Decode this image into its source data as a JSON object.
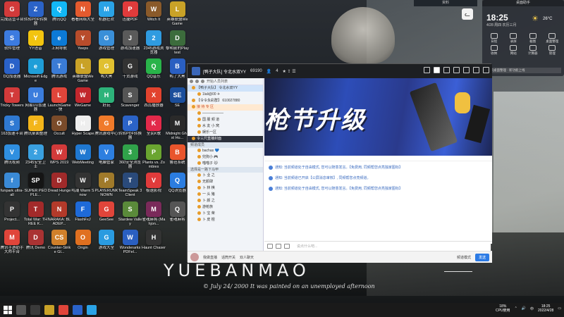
{
  "desktop_icons": [
    {
      "label": "完成运营平台",
      "color": "#d23a3a",
      "glyph": "G"
    },
    {
      "label": "转转PDF转换器",
      "color": "#2b63c7",
      "glyph": "Z"
    },
    {
      "label": "腾讯QQ",
      "color": "#12b7f5",
      "glyph": "Q"
    },
    {
      "label": "看看网络大全",
      "color": "#e45a2e",
      "glyph": "N"
    },
    {
      "label": "机器狂欢",
      "color": "#2aa3e6",
      "glyph": "M"
    },
    {
      "label": "迅捷PDF",
      "color": "#e03b3b",
      "glyph": "P"
    },
    {
      "label": "Witch It",
      "color": "#8a5a2a",
      "glyph": "W"
    },
    {
      "label": "英雄联盟WeGame",
      "color": "#c9a227",
      "glyph": "L"
    },
    {
      "label": "软件管理",
      "color": "#3c7be0",
      "glyph": "S"
    },
    {
      "label": "YY语音",
      "color": "#f2c40f",
      "glyph": "Y"
    },
    {
      "label": "上网导航",
      "color": "#0c7ad6",
      "glyph": "e"
    },
    {
      "label": "Yeeps",
      "color": "#b84c2b",
      "glyph": "Y"
    },
    {
      "label": "游戏管理",
      "color": "#3a8fd8",
      "glyph": "G"
    },
    {
      "label": "游戏加速器",
      "color": "#5a5a5a",
      "glyph": "J"
    },
    {
      "label": "2345游戏浏览器",
      "color": "#2f9be0",
      "glyph": "2"
    },
    {
      "label": "黎明前的Playtest",
      "color": "#3c6c3c",
      "glyph": "D"
    },
    {
      "label": "DQ加速器",
      "color": "#2a62c9",
      "glyph": "D"
    },
    {
      "label": "Microsoft Edge",
      "color": "#1f9ed8",
      "glyph": "e"
    },
    {
      "label": "腾讯游戏",
      "color": "#3a7bd5",
      "glyph": "T"
    },
    {
      "label": "英雄联盟WeGame",
      "color": "#c9a227",
      "glyph": "L"
    },
    {
      "label": "鸭大黑",
      "color": "#e0c030",
      "glyph": "G"
    },
    {
      "label": "干货游戏",
      "color": "#333",
      "glyph": "G"
    },
    {
      "label": "QQ音乐",
      "color": "#29b34a",
      "glyph": "Q"
    },
    {
      "label": "鸭了大黑",
      "color": "#2a5fc1",
      "glyph": "B"
    },
    {
      "label": "Tricky Towers",
      "color": "#d23a3a",
      "glyph": "T"
    },
    {
      "label": "网易UU加速器",
      "color": "#3b7ddd",
      "glyph": "U"
    },
    {
      "label": "LaunchGame - 快",
      "color": "#e0453a",
      "glyph": "L"
    },
    {
      "label": "WeGame",
      "color": "#c2272d",
      "glyph": "W"
    },
    {
      "label": "好玩",
      "color": "#2db37a",
      "glyph": "H"
    },
    {
      "label": "Scavenger",
      "color": "#555",
      "glyph": "S"
    },
    {
      "label": "西瓜播放器",
      "color": "#e2432e",
      "glyph": "X"
    },
    {
      "label": "SE",
      "color": "#1b4f9c",
      "glyph": "SE"
    },
    {
      "label": "163加速平台",
      "color": "#2f79d2",
      "glyph": "S"
    },
    {
      "label": "腾讯桌面整理",
      "color": "#f3b51a",
      "glyph": "F"
    },
    {
      "label": "Occult",
      "color": "#7a4b2a",
      "glyph": "O"
    },
    {
      "label": "Hyper Scape",
      "color": "#eeeeee",
      "glyph": "H"
    },
    {
      "label": "腾讯游戏中心",
      "color": "#f07a2a",
      "glyph": "G"
    },
    {
      "label": "转转PDF转换器",
      "color": "#2b63c7",
      "glyph": "P"
    },
    {
      "label": "全民K歌",
      "color": "#e2294a",
      "glyph": "K"
    },
    {
      "label": "Midnight Ghost Hu...",
      "color": "#2a2a2a",
      "glyph": "M"
    },
    {
      "label": "腾讯视频",
      "color": "#2f8fe0",
      "glyph": "V"
    },
    {
      "label": "2345安全卫士",
      "color": "#3aa0e0",
      "glyph": "2"
    },
    {
      "label": "WPS 2019",
      "color": "#d23a3a",
      "glyph": "W"
    },
    {
      "label": "WebMeeting",
      "color": "#1f78d1",
      "glyph": "W"
    },
    {
      "label": "电脑管家",
      "color": "#2d7fe0",
      "glyph": "V"
    },
    {
      "label": "360安全浏览器",
      "color": "#30a24a",
      "glyph": "3"
    },
    {
      "label": "Plants vs. Zombies",
      "color": "#6aa530",
      "glyph": "P"
    },
    {
      "label": "鲁班系统",
      "color": "#e9552c",
      "glyph": "B"
    },
    {
      "label": "funpark ultra-all",
      "color": "#3a8ad6",
      "glyph": "f"
    },
    {
      "label": "SUPER PEOPLE...",
      "color": "#151515",
      "glyph": "SP"
    },
    {
      "label": "Dread Hunger",
      "color": "#a02a2a",
      "glyph": "D"
    },
    {
      "label": "鸣潮 Warm Snow",
      "color": "#333",
      "glyph": "W"
    },
    {
      "label": "PLAYERUNKNOWN",
      "color": "#a07a2a",
      "glyph": "P"
    },
    {
      "label": "TeamSpeak 3 Client",
      "color": "#2a4a7a",
      "glyph": "T"
    },
    {
      "label": "极速影视",
      "color": "#e03b3b",
      "glyph": "V"
    },
    {
      "label": "QQ浏览器",
      "color": "#2b7de0",
      "glyph": "Q"
    },
    {
      "label": "Project...",
      "color": "#333",
      "glyph": "P"
    },
    {
      "label": "Total War: THREE K...",
      "color": "#a32a2a",
      "glyph": "T"
    },
    {
      "label": "NARAKA: BLADEP...",
      "color": "#b33a2a",
      "glyph": "N"
    },
    {
      "label": "FlashFxJ",
      "color": "#1e6ad8",
      "glyph": "F"
    },
    {
      "label": "GeeSee",
      "color": "#e0453a",
      "glyph": "G"
    },
    {
      "label": "Stardew Valley",
      "color": "#5a8a3a",
      "glyph": "S"
    },
    {
      "label": "雀魂麻将 (Mahjon...",
      "color": "#7a2a5a",
      "glyph": "M"
    },
    {
      "label": "雀魂麻将",
      "color": "#555",
      "glyph": "Q"
    },
    {
      "label": "腾讯手游助手 大师平台",
      "color": "#e0453a",
      "glyph": "M"
    },
    {
      "label": "腾讯 Demo",
      "color": "#a33",
      "glyph": "D"
    },
    {
      "label": "Counter-Strike Gl...",
      "color": "#d0802a",
      "glyph": "CS"
    },
    {
      "label": "Origin",
      "color": "#e07020",
      "glyph": "O"
    },
    {
      "label": "游戏大全",
      "color": "#2a9be0",
      "glyph": "G"
    },
    {
      "label": "Wonderarks PDFel...",
      "color": "#2a5fc1",
      "glyph": "W"
    },
    {
      "label": "Haunt Chaser",
      "color": "#333",
      "glyph": "H"
    }
  ],
  "branding": {
    "title": "YUEBANMAO",
    "subtitle": "© July 24/ 2000 It was painted on an unemployed afternoon"
  },
  "top_strip": "资料",
  "panel": {
    "title": "桌面助手",
    "time": "18:25",
    "date": "4/28 周四 农历三月",
    "weather_icon": "sun-icon",
    "temp": "26°C",
    "buttons": [
      "日程",
      "录屏",
      "截图",
      "桌面整理",
      "收纳",
      "网站",
      "计算器",
      "管理"
    ],
    "note": "腾讯桌面整理 · 新功能上线"
  },
  "app": {
    "title": "[鸭子大队] 令北水双YY",
    "meta_id": "69190",
    "meta_count": "4",
    "banner_text": "枪节升级",
    "sidebar_tab": "开始人员列表",
    "channels": [
      {
        "label": "【鸭子大队】 令北水双YY",
        "cls": "sel"
      },
      {
        "label": "1lali@00  ✈",
        "cls": "indent"
      },
      {
        "label": "【令令永彩群】  610027880",
        "cls": ""
      },
      {
        "label": "接 待 专 区",
        "cls": "hl"
      },
      {
        "label": "——————",
        "cls": "indent"
      },
      {
        "label": "国 服 频 道",
        "cls": "indent"
      },
      {
        "label": "水 友 小 窝",
        "cls": "indent"
      },
      {
        "label": "娱乐一区",
        "cls": "indent"
      },
      {
        "label": "令三尺直播封面",
        "cls": "dark"
      }
    ],
    "user_section": "频道成员",
    "users": [
      "bachas 💙",
      "兜狗小 🎮",
      "喵喵子 🐱"
    ],
    "sub_section": "选择是一路下马甲",
    "sub_rows": [
      "卜 业 之",
      "无颜肆",
      "卜 林 棋",
      "一 头 猪",
      "卜 颜 之",
      "游枪族",
      "卜 宝 荣",
      "卜 皮 棍"
    ],
    "messages": [
      "通知: 当前频道处于自由模式, 您可以随意发言。【免费用, 同频帮您点亮独家图标】",
      "通知: 当前频道已开启【公屏消息审核】, 同频帮您点亮频道。",
      "通知: 当前频道处于自由模式, 您可以随意发言。【免费用, 同频帮您点亮独家图标】"
    ],
    "input_placeholder": "说点什么吧...",
    "footer_items": [
      "我做直播",
      "话筒开关",
      "双人聊天"
    ],
    "footer_right": "频道模式",
    "send_label": "发送"
  },
  "tray": {
    "cpu": "18%",
    "cpu_label": "CPU使用",
    "lang": "中",
    "time": "18:25",
    "date": "2022/4/28"
  }
}
